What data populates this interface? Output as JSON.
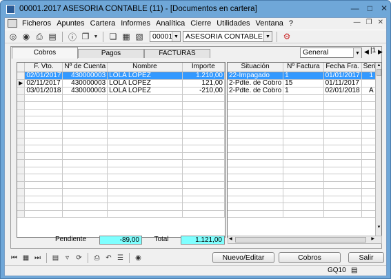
{
  "window": {
    "title": "00001.2017 ASESORIA CONTABLE (11) - [Documentos en cartera]"
  },
  "menu": [
    "Ficheros",
    "Apuntes",
    "Cartera",
    "Informes",
    "Analítica",
    "Cierre",
    "Utilidades",
    "Ventana",
    "?"
  ],
  "toolbar": {
    "company_code": "00001",
    "company_name": "ASESORIA CONTABLE"
  },
  "tabs": [
    "Cobros",
    "Pagos",
    "FACTURAS"
  ],
  "view_select": "General",
  "nav_label": "|1",
  "grid_left": {
    "headers": [
      "F. Vto.",
      "Nº de Cuenta",
      "Nombre",
      "Importe"
    ],
    "rows": [
      [
        "02/01/2017",
        "430000003",
        "LOLA LOPEZ",
        "1.210,00"
      ],
      [
        "02/11/2017",
        "430000003",
        "LOLA LOPEZ",
        "121,00"
      ],
      [
        "03/01/2018",
        "430000003",
        "LOLA LOPEZ",
        "-210,00"
      ]
    ]
  },
  "grid_right": {
    "headers": [
      "Situación",
      "Nº Factura",
      "Fecha Fra.",
      "Serie"
    ],
    "rows": [
      [
        "22-Impagado",
        "1",
        "01/01/2017",
        "1"
      ],
      [
        "2-Pdte. de Cobro",
        "15",
        "01/11/2017",
        ""
      ],
      [
        "2-Pdte. de Cobro",
        "1",
        "02/01/2018",
        "A"
      ]
    ]
  },
  "totals": {
    "pendiente_label": "Pendiente",
    "pendiente_value": "-89,00",
    "total_label": "Total",
    "total_value": "1.121,00"
  },
  "buttons": {
    "nuevo": "Nuevo/Editar",
    "cobros": "Cobros",
    "salir": "Salir"
  },
  "status": {
    "code": "GQ10"
  }
}
